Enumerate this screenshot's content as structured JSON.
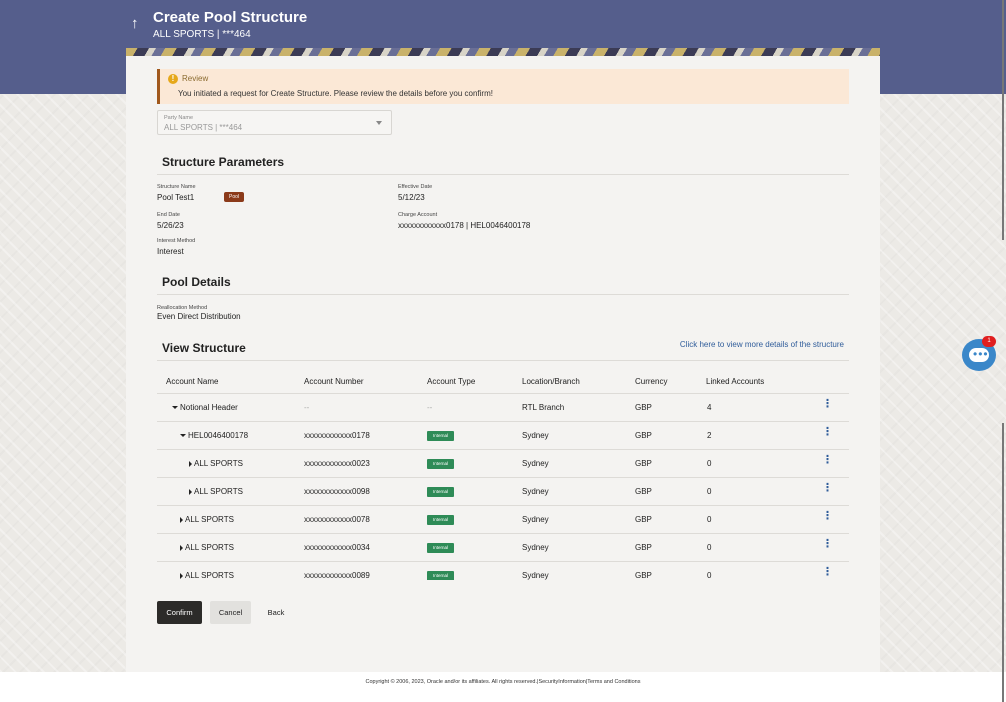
{
  "header": {
    "back_icon": "arrow-up-icon",
    "title": "Create Pool Structure",
    "subtitle": "ALL SPORTS | ***464"
  },
  "review": {
    "title": "Review",
    "message": "You initiated a request for Create Structure. Please review the details before you confirm!"
  },
  "party": {
    "label": "Party Name",
    "value": "ALL SPORTS | ***464"
  },
  "structure_parameters": {
    "title": "Structure Parameters",
    "structure_name_label": "Structure Name",
    "structure_name": "Pool Test1",
    "pool_badge": "Pool",
    "effective_date_label": "Effective Date",
    "effective_date": "5/12/23",
    "end_date_label": "End Date",
    "end_date": "5/26/23",
    "charge_account_label": "Charge Account",
    "charge_account": "xxxxxxxxxxxx0178 | HEL0046400178",
    "interest_method_label": "Interest Method",
    "interest_method": "Interest"
  },
  "pool_details": {
    "title": "Pool Details",
    "reallocation_label": "Reallocation Method",
    "reallocation_value": "Even Direct Distribution"
  },
  "view_structure": {
    "title": "View Structure",
    "link": "Click here to view more details of the structure",
    "columns": {
      "account_name": "Account Name",
      "account_number": "Account Number",
      "account_type": "Account Type",
      "location": "Location/Branch",
      "currency": "Currency",
      "linked": "Linked Accounts"
    },
    "rows": [
      {
        "name": "Notional Header",
        "number": "--",
        "type": "--",
        "location": "RTL Branch",
        "currency": "GBP",
        "linked": "4"
      },
      {
        "name": "HEL0046400178",
        "number": "xxxxxxxxxxxx0178",
        "type": "Internal",
        "location": "Sydney",
        "currency": "GBP",
        "linked": "2"
      },
      {
        "name": "ALL SPORTS",
        "number": "xxxxxxxxxxxx0023",
        "type": "Internal",
        "location": "Sydney",
        "currency": "GBP",
        "linked": "0"
      },
      {
        "name": "ALL SPORTS",
        "number": "xxxxxxxxxxxx0098",
        "type": "Internal",
        "location": "Sydney",
        "currency": "GBP",
        "linked": "0"
      },
      {
        "name": "ALL SPORTS",
        "number": "xxxxxxxxxxxx0078",
        "type": "Internal",
        "location": "Sydney",
        "currency": "GBP",
        "linked": "0"
      },
      {
        "name": "ALL SPORTS",
        "number": "xxxxxxxxxxxx0034",
        "type": "Internal",
        "location": "Sydney",
        "currency": "GBP",
        "linked": "0"
      },
      {
        "name": "ALL SPORTS",
        "number": "xxxxxxxxxxxx0089",
        "type": "Internal",
        "location": "Sydney",
        "currency": "GBP",
        "linked": "0"
      }
    ]
  },
  "actions": {
    "confirm": "Confirm",
    "cancel": "Cancel",
    "back": "Back"
  },
  "footer": {
    "text": "Copyright © 2006, 2023, Oracle and/or its affiliates. All rights reserved.|SecurityInformation|Terms and Conditions"
  },
  "chat": {
    "icon": "chatbot-icon",
    "count": "1"
  }
}
